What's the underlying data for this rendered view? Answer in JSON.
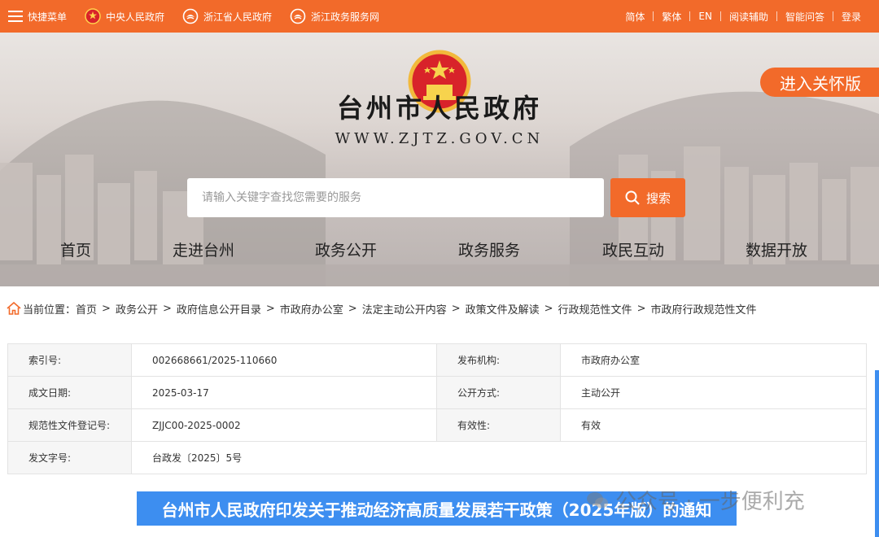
{
  "topbar": {
    "menu_label": "快捷菜单",
    "links": [
      "中央人民政府",
      "浙江省人民政府",
      "浙江政务服务网"
    ],
    "right_links": [
      "简体",
      "繁体",
      "EN",
      "阅读辅助",
      "智能问答",
      "登录"
    ]
  },
  "banner": {
    "title": "台州市人民政府",
    "url": "WWW.ZJTZ.GOV.CN",
    "care_label": "进入关怀版"
  },
  "search": {
    "placeholder": "请输入关键字查找您需要的服务",
    "button_label": "搜索"
  },
  "nav": [
    "首页",
    "走进台州",
    "政务公开",
    "政务服务",
    "政民互动",
    "数据开放"
  ],
  "breadcrumb": {
    "prefix": "当前位置：",
    "items": [
      "首页",
      "政务公开",
      "政府信息公开目录",
      "市政府办公室",
      "法定主动公开内容",
      "政策文件及解读",
      "行政规范性文件",
      "市政府行政规范性文件"
    ]
  },
  "meta": {
    "rows": [
      {
        "l1": "索引号:",
        "v1": "002668661/2025-110660",
        "l2": "发布机构:",
        "v2": "市政府办公室"
      },
      {
        "l1": "成文日期:",
        "v1": "2025-03-17",
        "l2": "公开方式:",
        "v2": "主动公开"
      },
      {
        "l1": "规范性文件登记号:",
        "v1": "ZJJC00-2025-0002",
        "l2": "有效性:",
        "v2": "有效"
      },
      {
        "l1": "发文字号:",
        "v1": "台政发〔2025〕5号"
      }
    ]
  },
  "document": {
    "title": "台州市人民政府印发关于推动经济高质量发展若干政策（2025年版）的通知"
  },
  "watermark": "公众号 · 一步便利充",
  "colors": {
    "accent": "#f26a2a",
    "highlight": "#3d8ef0"
  }
}
